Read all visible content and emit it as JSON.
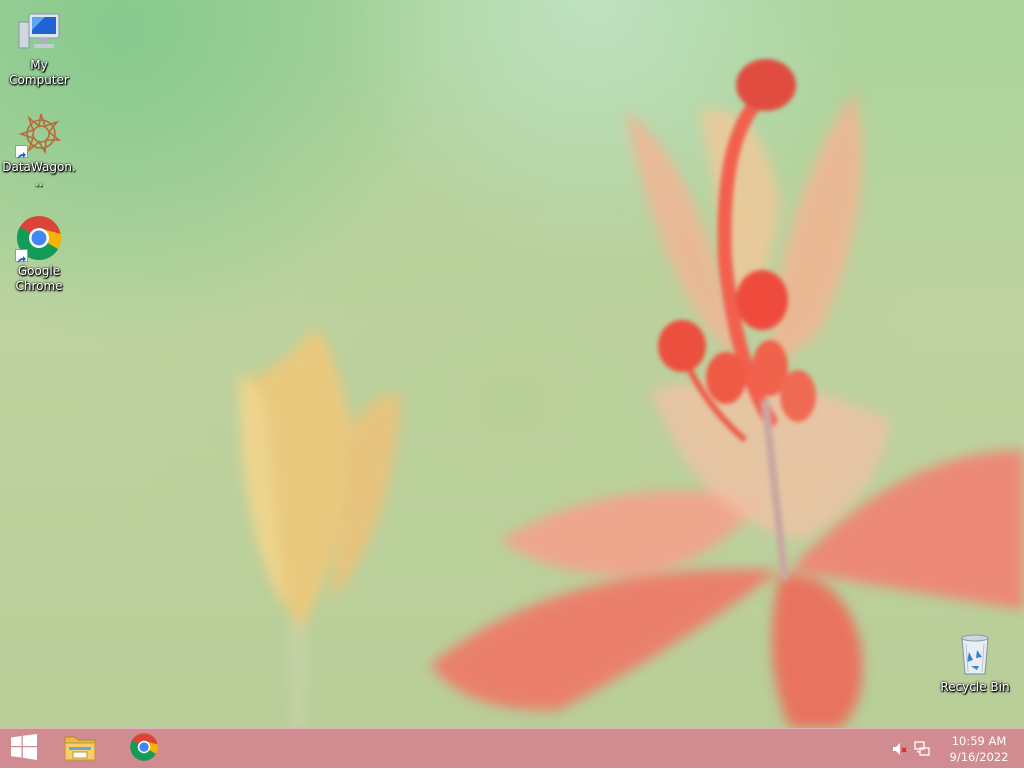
{
  "desktop": {
    "icons": [
      {
        "label": "My Computer",
        "icon": "computer-icon"
      },
      {
        "label": "DataWagon...",
        "icon": "datawagon-icon"
      },
      {
        "label": "Google Chrome",
        "icon": "chrome-icon"
      },
      {
        "label": "Recycle Bin",
        "icon": "recycle-bin-icon"
      }
    ]
  },
  "taskbar": {
    "start_icon": "windows-logo-icon",
    "pinned": [
      {
        "name": "File Explorer",
        "icon": "folder-icon"
      },
      {
        "name": "Google Chrome",
        "icon": "chrome-icon"
      }
    ],
    "tray": {
      "volume_icon": "volume-muted-icon",
      "network_icon": "network-icon",
      "time": "10:59 AM",
      "date": "9/16/2022"
    }
  },
  "colors": {
    "taskbar": "#ce858a",
    "wallpaper_green": "#b9cf9a",
    "flower_red": "#f06a5c",
    "flower_yellow": "#f2c878"
  }
}
